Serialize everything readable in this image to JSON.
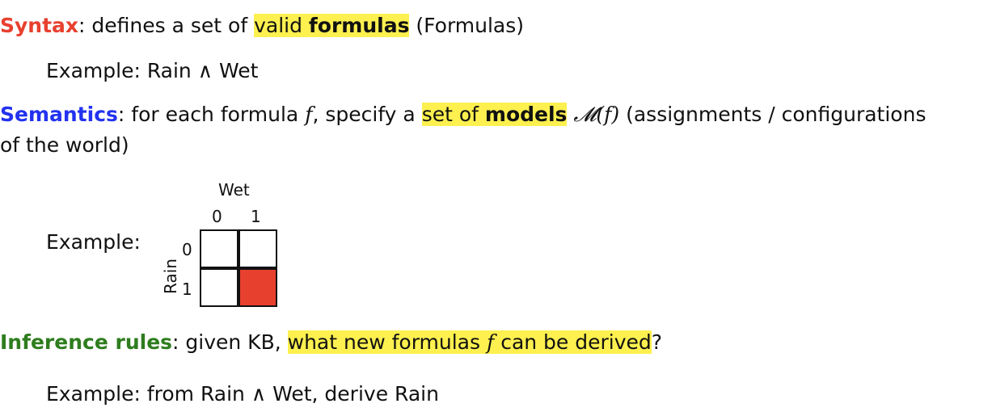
{
  "syntax": {
    "term": "Syntax",
    "term_color": "#e8402f",
    "text_a": ": defines a set of ",
    "hl_a": "valid ",
    "hl_b": "formulas",
    "text_b": " (Formulas)",
    "example_label": "Example: ",
    "example_text": "Rain ∧ Wet"
  },
  "semantics": {
    "term": "Semantics",
    "term_color": "#2232f0",
    "text_a": ": for each formula ",
    "f": "f",
    "text_b": ", specify a ",
    "hl_a": "set of ",
    "hl_b": "models",
    "M": "𝓜",
    "Mf": "(f)",
    "text_c": " (assignments / configurations",
    "line2": "of the world)",
    "example_label": "Example:"
  },
  "model_grid": {
    "col_axis": "Wet",
    "row_axis": "Rain",
    "col_ticks": [
      "0",
      "1"
    ],
    "row_ticks": [
      "0",
      "1"
    ],
    "filled_color": "#e8402f",
    "cells": [
      {
        "row": "0",
        "col": "0",
        "filled": false
      },
      {
        "row": "0",
        "col": "1",
        "filled": false
      },
      {
        "row": "1",
        "col": "0",
        "filled": false
      },
      {
        "row": "1",
        "col": "1",
        "filled": true
      }
    ]
  },
  "inference": {
    "term": "Inference rules",
    "term_color": "#2e7d1e",
    "text_a": ": given KB, ",
    "hl_a": "what new formulas ",
    "f": "f",
    "hl_b": " can be derived",
    "text_b": "?",
    "example_label": "Example: ",
    "example_text": "from Rain ∧ Wet, derive Rain"
  },
  "highlight_color": "#fdf04f"
}
